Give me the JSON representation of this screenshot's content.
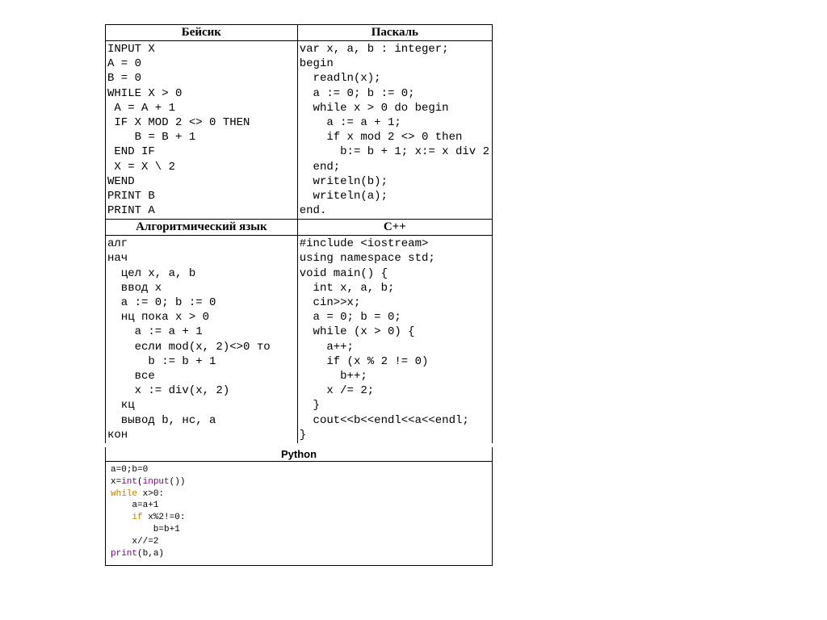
{
  "headers": {
    "basic": "Бейсик",
    "pascal": "Паскаль",
    "algo": "Алгоритмический язык",
    "cpp": "С++",
    "python": "Python"
  },
  "code": {
    "basic": "INPUT X\nA = 0\nB = 0\nWHILE X > 0\n A = A + 1\n IF X MOD 2 <> 0 THEN\n    B = B + 1\n END IF\n X = X \\ 2\nWEND\nPRINT B\nPRINT A",
    "pascal": "var x, a, b : integer;\nbegin\n  readln(x);\n  a := 0; b := 0;\n  while x > 0 do begin\n    a := a + 1;\n    if x mod 2 <> 0 then\n      b:= b + 1; x:= x div 2\n  end;\n  writeln(b);\n  writeln(a);\nend.",
    "algo": "алг\nнач\n  цел x, a, b\n  ввод x\n  a := 0; b := 0\n  нц пока x > 0\n    a := a + 1\n    если mod(x, 2)<>0 то\n      b := b + 1\n    все\n    x := div(x, 2)\n  кц\n  вывод b, нс, a\nкон",
    "cpp": "#include <iostream>\nusing namespace std;\nvoid main() {\n  int x, a, b;\n  cin>>x;\n  a = 0; b = 0;\n  while (x > 0) {\n    a++;\n    if (x % 2 != 0)\n      b++;\n    x /= 2;\n  }\n  cout<<b<<endl<<a<<endl;\n}"
  },
  "python_tokens": [
    [
      "plain",
      "a="
    ],
    [
      "num",
      "0"
    ],
    [
      "plain",
      ";b="
    ],
    [
      "num",
      "0"
    ],
    [
      "nl",
      ""
    ],
    [
      "plain",
      "x="
    ],
    [
      "builtin",
      "int"
    ],
    [
      "plain",
      "("
    ],
    [
      "builtin",
      "input"
    ],
    [
      "plain",
      "())"
    ],
    [
      "nl",
      ""
    ],
    [
      "kw",
      "while"
    ],
    [
      "plain",
      " x>"
    ],
    [
      "num",
      "0"
    ],
    [
      "plain",
      ":"
    ],
    [
      "nl",
      ""
    ],
    [
      "plain",
      "    a=a+"
    ],
    [
      "num",
      "1"
    ],
    [
      "nl",
      ""
    ],
    [
      "plain",
      "    "
    ],
    [
      "kw",
      "if"
    ],
    [
      "plain",
      " x%"
    ],
    [
      "num",
      "2"
    ],
    [
      "plain",
      "!="
    ],
    [
      "num",
      "0"
    ],
    [
      "plain",
      ":"
    ],
    [
      "nl",
      ""
    ],
    [
      "plain",
      "        b=b+"
    ],
    [
      "num",
      "1"
    ],
    [
      "nl",
      ""
    ],
    [
      "plain",
      "    x//="
    ],
    [
      "num",
      "2"
    ],
    [
      "nl",
      ""
    ],
    [
      "builtin",
      "print"
    ],
    [
      "plain",
      "(b,a)"
    ]
  ]
}
